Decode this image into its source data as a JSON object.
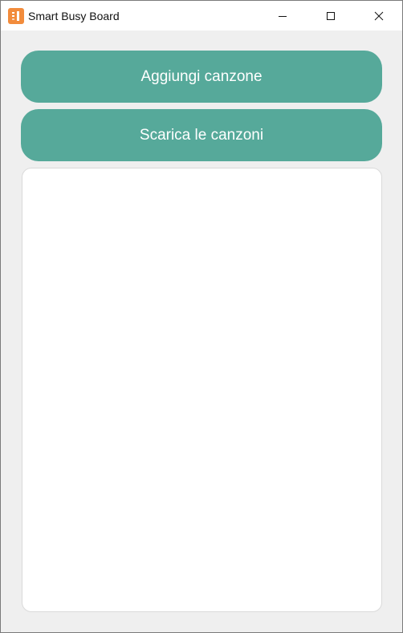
{
  "window": {
    "title": "Smart Busy Board",
    "app_icon": "app-logo-icon",
    "controls": {
      "minimize_icon": "minimize-icon",
      "maximize_icon": "maximize-icon",
      "close_icon": "close-icon"
    }
  },
  "main": {
    "add_song_label": "Aggiungi canzone",
    "download_songs_label": "Scarica le canzoni",
    "song_list": {
      "items": []
    }
  },
  "colors": {
    "accent": "#56a99a",
    "app_icon": "#f28c3c",
    "background": "#efefef",
    "list_background": "#ffffff"
  }
}
